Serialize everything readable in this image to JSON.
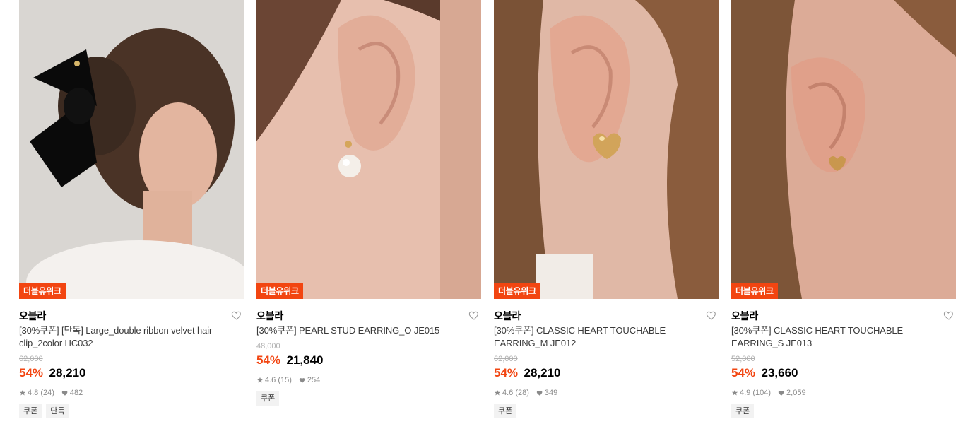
{
  "products": [
    {
      "badge": "더블유위크",
      "brand": "오블라",
      "title": "[30%쿠폰] [단독] Large_double ribbon velvet hair clip_2color HC032",
      "original_price": "62,000",
      "discount": "54%",
      "price": "28,210",
      "rating": "4.8",
      "reviews": "(24)",
      "likes": "482",
      "tags": [
        "쿠폰",
        "단독"
      ]
    },
    {
      "badge": "더블유위크",
      "brand": "오블라",
      "title": "[30%쿠폰] PEARL STUD EARRING_O JE015",
      "original_price": "48,000",
      "discount": "54%",
      "price": "21,840",
      "rating": "4.6",
      "reviews": "(15)",
      "likes": "254",
      "tags": [
        "쿠폰"
      ]
    },
    {
      "badge": "더블유위크",
      "brand": "오블라",
      "title": "[30%쿠폰] CLASSIC HEART TOUCHABLE EARRING_M JE012",
      "original_price": "62,000",
      "discount": "54%",
      "price": "28,210",
      "rating": "4.6",
      "reviews": "(28)",
      "likes": "349",
      "tags": [
        "쿠폰"
      ]
    },
    {
      "badge": "더블유위크",
      "brand": "오블라",
      "title": "[30%쿠폰] CLASSIC HEART TOUCHABLE EARRING_S JE013",
      "original_price": "52,000",
      "discount": "54%",
      "price": "23,660",
      "rating": "4.9",
      "reviews": "(104)",
      "likes": "2,059",
      "tags": [
        "쿠폰"
      ]
    }
  ],
  "icons": {
    "like": "heart-outline-icon",
    "star": "star-icon",
    "heart": "heart-icon"
  },
  "colors": {
    "accent": "#f24511",
    "badge_text": "#ffffff",
    "muted": "#8a8a8a"
  }
}
